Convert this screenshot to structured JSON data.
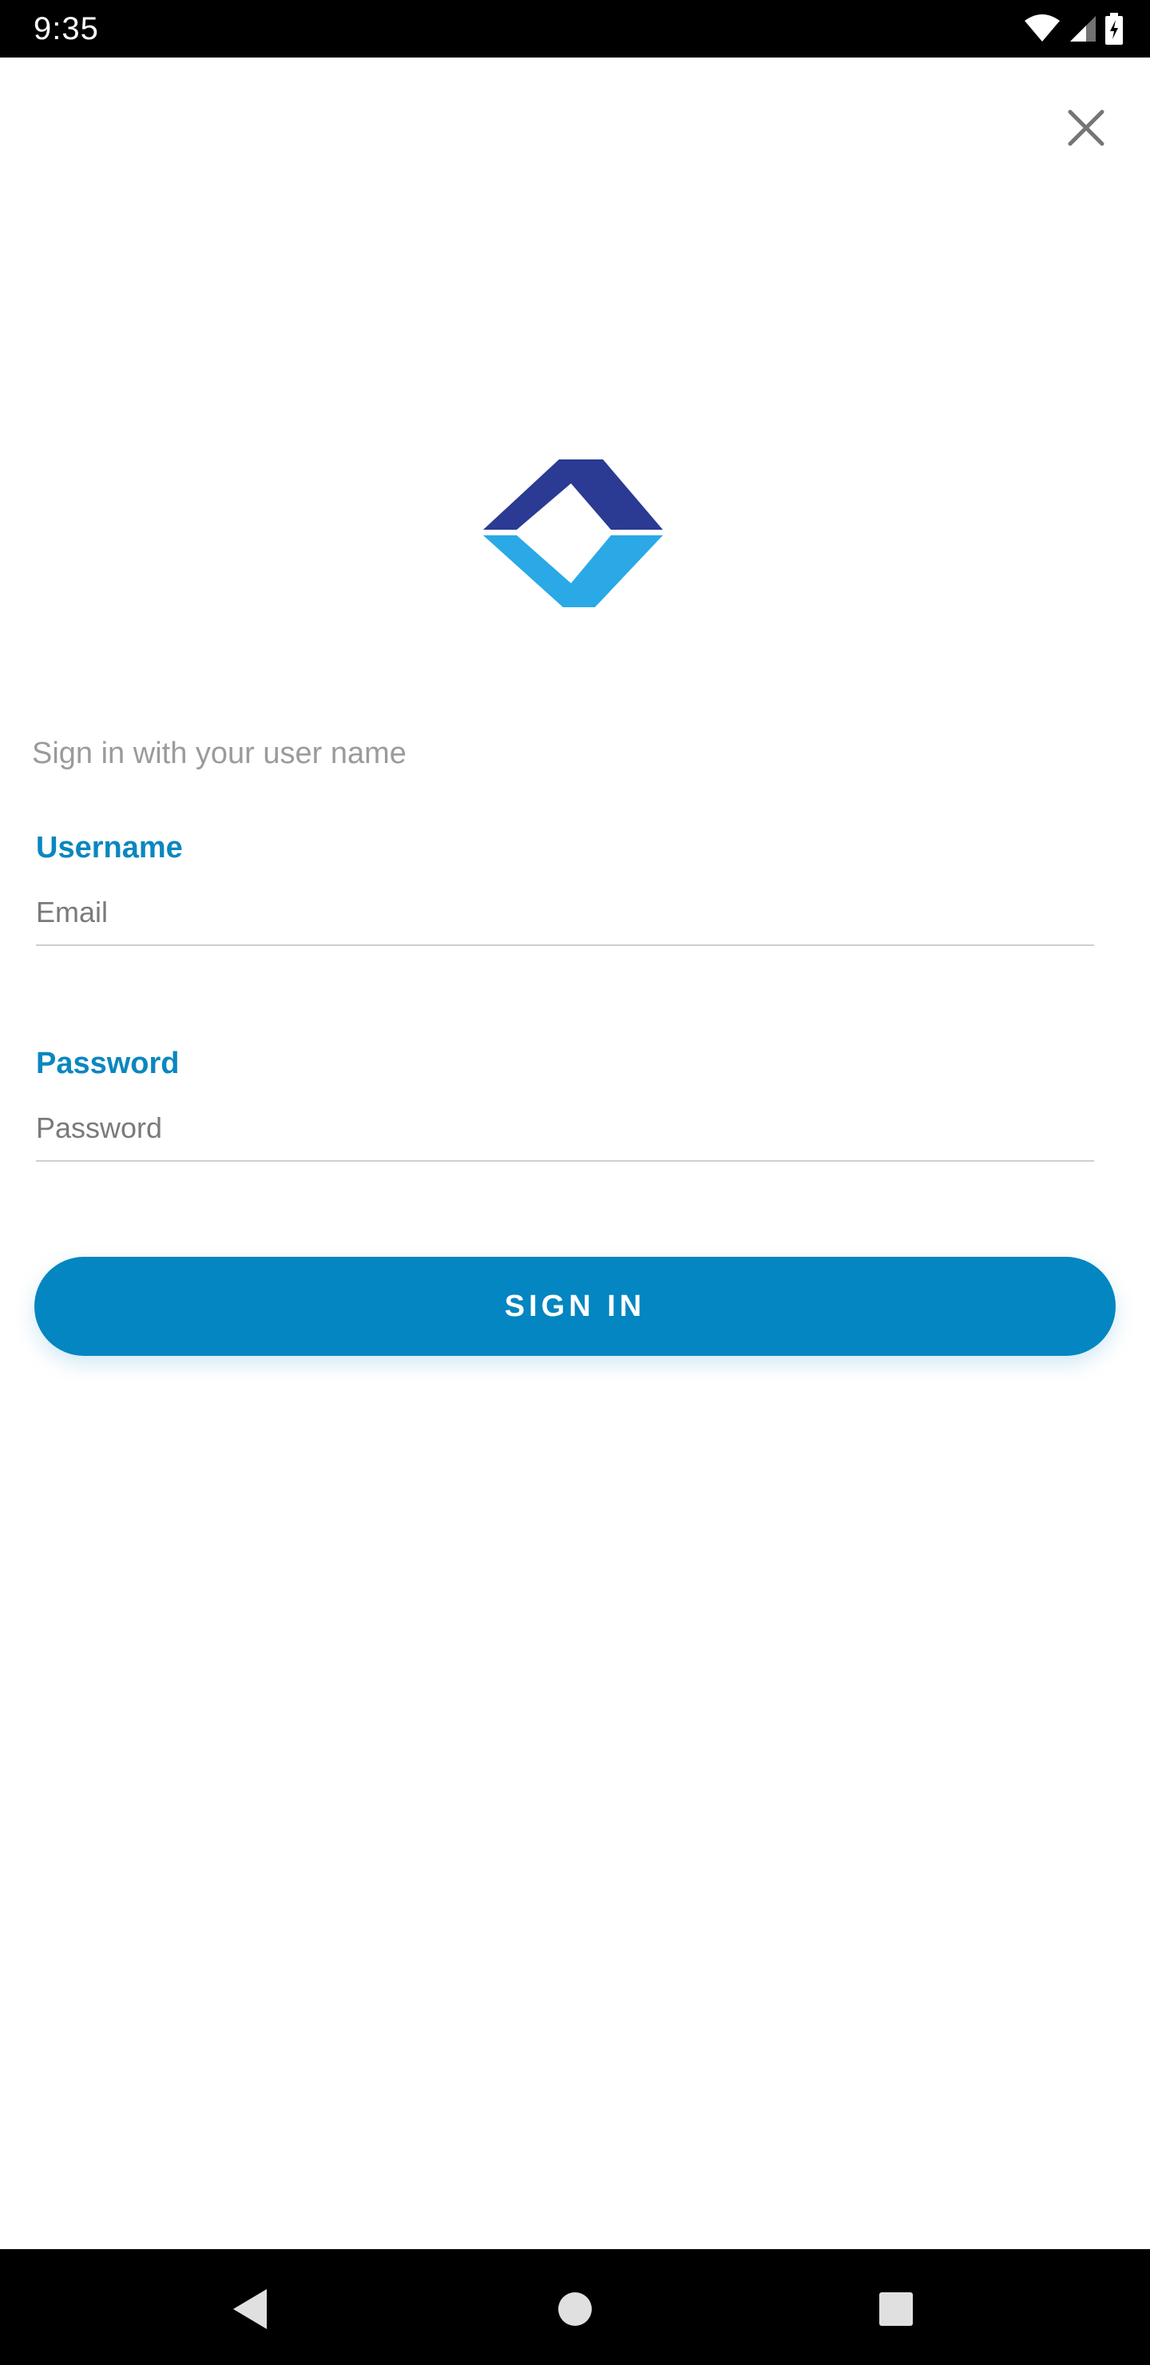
{
  "status_bar": {
    "time": "9:35",
    "icons": [
      "wifi-icon",
      "signal-icon",
      "battery-charging-icon"
    ]
  },
  "header": {
    "close_icon": "close-icon"
  },
  "brand": {
    "logo_icon": "diamond-chevron-logo",
    "colors": {
      "dark": "#2b3a93",
      "light": "#2aa9e6"
    }
  },
  "form": {
    "subtitle": "Sign in with your user name",
    "username": {
      "label": "Username",
      "placeholder": "Email",
      "value": ""
    },
    "password": {
      "label": "Password",
      "placeholder": "Password",
      "value": ""
    },
    "submit_label": "SIGN IN"
  },
  "nav_bar": {
    "icons": [
      "back-icon",
      "home-icon",
      "recents-icon"
    ]
  },
  "theme": {
    "accent": "#0386c1",
    "label_color": "#0a87bf",
    "placeholder_color": "#7a7a7a"
  }
}
